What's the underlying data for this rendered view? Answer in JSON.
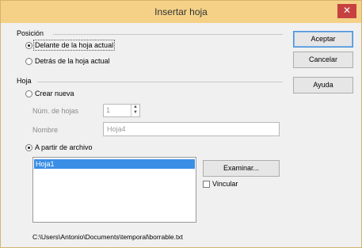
{
  "window": {
    "title": "Insertar hoja",
    "close_glyph": "✕"
  },
  "position": {
    "label": "Posición",
    "options": [
      "Delante de la hoja actual",
      "Detrás de la hoja actual"
    ],
    "selected": "Delante de la hoja actual"
  },
  "sheet": {
    "label": "Hoja",
    "new_option": "Crear nueva",
    "num_label": "Núm. de hojas",
    "num_value": "1",
    "name_label": "Nombre",
    "name_value": "Hoja4",
    "from_file_option": "A partir de archivo",
    "list_items": [
      "Hoja1"
    ],
    "selected_item": "Hoja1",
    "browse_label": "Examinar...",
    "link_label": "Vincular",
    "file_path": "C:\\Users\\Antonio\\Documents\\temporal\\borrable.txt"
  },
  "buttons": {
    "ok": "Aceptar",
    "cancel": "Cancelar",
    "help": "Ayuda"
  },
  "colors": {
    "titlebar": "#f4d187",
    "close": "#c74040",
    "selection": "#3a8ee6"
  }
}
